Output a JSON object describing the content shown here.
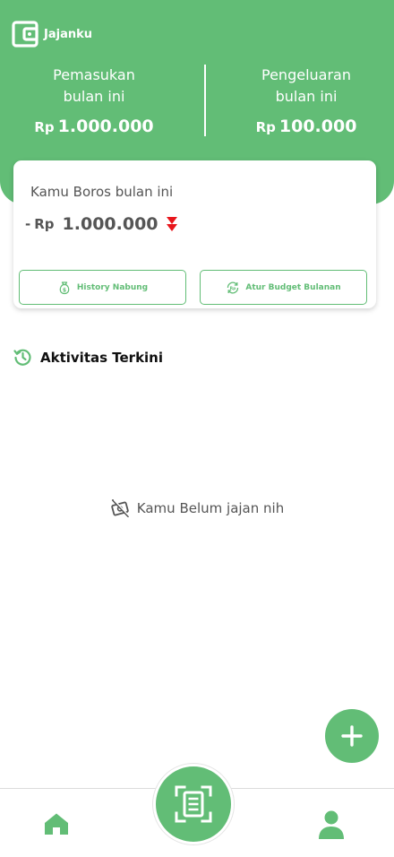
{
  "app": {
    "name": "Jajanku",
    "logo_icon": "wallet-icon"
  },
  "colors": {
    "primary": "#62bd76",
    "alert": "#e8161c",
    "text": "#555555"
  },
  "summary": {
    "income": {
      "label_line1": "Pemasukan",
      "label_line2": "bulan ini",
      "currency": "Rp",
      "amount": "1.000.000"
    },
    "expense": {
      "label_line1": "Pengeluaran",
      "label_line2": "bulan ini",
      "currency": "Rp",
      "amount": "100.000"
    }
  },
  "card": {
    "title": "Kamu Boros bulan ini",
    "sign": "-",
    "currency": "Rp",
    "amount": "1.000.000",
    "trend_icon": "double-arrow-down-icon",
    "buttons": [
      {
        "label": "History Nabung",
        "icon": "money-bag-icon"
      },
      {
        "label": "Atur Budget Bulanan",
        "icon": "refresh-budget-icon"
      }
    ]
  },
  "activity": {
    "title": "Aktivitas Terkini",
    "icon": "history-icon",
    "empty_text": "Kamu Belum jajan nih",
    "empty_icon": "no-cash-icon"
  },
  "fab": {
    "icon": "plus-icon"
  },
  "nav": {
    "home_icon": "home-icon",
    "scan_icon": "receipt-scan-icon",
    "profile_icon": "user-icon"
  }
}
